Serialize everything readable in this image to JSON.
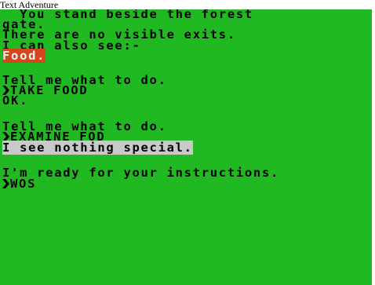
{
  "window": {
    "title": "Text Adventure"
  },
  "colors": {
    "screen_background": "#21b921",
    "text": "#000000",
    "object_highlight_bg": "#d4461e",
    "object_highlight_fg": "#f2f2f2",
    "response_highlight_bg": "#c9c9c9"
  },
  "game": {
    "room_description_1": "  You stand beside the forest",
    "room_description_2": "gate.",
    "exits": "There are no visible exits.",
    "also_see": "I can also see:-",
    "object_food": "Food.",
    "prompt_1": "Tell me what to do.",
    "command_1": "TAKE FOOD",
    "response_1": "OK.",
    "prompt_2": "Tell me what to do.",
    "command_2": "EXAMINE FOD",
    "response_2": "I see nothing special.",
    "prompt_3": "I'm ready for your instructions.",
    "current_input": "WOS",
    "cursor_icon": "prompt-arrow-icon"
  }
}
